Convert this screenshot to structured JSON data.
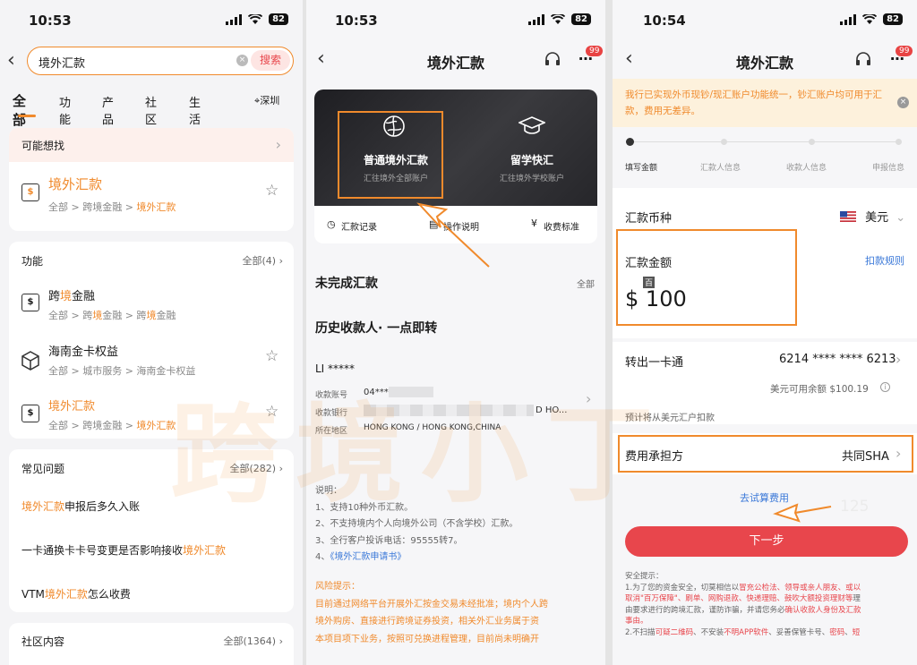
{
  "panel1": {
    "status": {
      "time": "10:53",
      "battery": "82"
    },
    "search": {
      "value": "境外汇款",
      "button": "搜索"
    },
    "tabs": [
      "全部",
      "功能",
      "产品",
      "社区",
      "生活"
    ],
    "location": "深圳",
    "maybe": {
      "title": "可能想找",
      "name": "境外汇款",
      "path_a": "全部 > 跨境金融 > ",
      "path_b": "境外汇款"
    },
    "functions": {
      "title": "功能",
      "all": "全部(4)",
      "items": [
        {
          "name_a": "跨",
          "name_b": "境",
          "name_c": "金融",
          "path_a": "全部 > 跨",
          "path_b": "境",
          "path_c": "金融 > 跨",
          "path_d": "境",
          "path_e": "金融"
        },
        {
          "name": "海南金卡权益",
          "path": "全部 > 城市服务 > 海南金卡权益"
        },
        {
          "name": "境外汇款",
          "path_a": "全部 > 跨境金融 > ",
          "path_b": "境外汇款"
        }
      ]
    },
    "faq": {
      "title": "常见问题",
      "all": "全部(282)",
      "q1_a": "境外汇款",
      "q1_b": "申报后多久入账",
      "q2_a": "一卡通换卡卡号变更是否影响接收",
      "q2_b": "境外汇款",
      "q3_a": "VTM",
      "q3_b": "境外汇款",
      "q3_c": "怎么收费"
    },
    "community": {
      "title": "社区内容",
      "all": "全部(1364)"
    }
  },
  "panel2": {
    "status": {
      "time": "10:53",
      "battery": "82"
    },
    "title": "境外汇款",
    "badge": "99",
    "banner": {
      "opt1_title": "普通境外汇款",
      "opt1_sub": "汇往境外全部账户",
      "opt2_title": "留学快汇",
      "opt2_sub": "汇往境外学校账户"
    },
    "links": [
      "汇款记录",
      "操作说明",
      "收费标准"
    ],
    "pending": {
      "title": "未完成汇款",
      "all": "全部"
    },
    "history_title": "历史收款人· 一点即转",
    "payee": {
      "name": "LI *****",
      "acct_label": "收款账号",
      "acct_value": "04***",
      "bank_label": "收款银行",
      "bank_value": "D HO...",
      "region_label": "所在地区",
      "region_value": "HONG KONG / HONG KONG,CHINA"
    },
    "notes": {
      "title": "说明：",
      "l1": "1、支持10种外币汇款。",
      "l2": "2、不支持境内个人向境外公司（不含学校）汇款。",
      "l3": "3、全行客户投诉电话：95555转7。",
      "l4_a": "4、",
      "l4_b": "《境外汇款申请书》"
    },
    "risk": {
      "title": "风险提示：",
      "l1": "目前通过网络平台开展外汇按金交易未经批准；境内个人跨",
      "l2": "境外购房、直接进行跨境证券投资，相关外汇业务属于资",
      "l3": "本项目项下业务，按照可兑换进程管理，目前尚未明确开"
    }
  },
  "panel3": {
    "status": {
      "time": "10:54",
      "battery": "82"
    },
    "title": "境外汇款",
    "badge": "99",
    "notice": "我行已实现外币现钞/现汇账户功能统一，钞汇账户均可用于汇款，费用无差异。",
    "steps": [
      "填写金额",
      "汇款人信息",
      "收款人信息",
      "申报信息"
    ],
    "currency": {
      "label": "汇款币种",
      "value": "美元"
    },
    "amount": {
      "label": "汇款金额",
      "rule": "扣款规则",
      "unit_hint": "百",
      "symbol": "$",
      "value": "100"
    },
    "account": {
      "label": "转出一卡通",
      "value": "6214 **** **** 6213",
      "balance": "美元可用余额 $100.19",
      "deduct_note": "预计将从美元汇户扣款"
    },
    "fee": {
      "label": "费用承担方",
      "value": "共同SHA"
    },
    "trial": "去试算费用",
    "faint_number": "125",
    "next_button": "下一步",
    "safety": {
      "title": "安全提示：",
      "p1_a": "1.为了您的资金安全，切莫相信以",
      "p1_b": "冒充公检法、领导或亲人朋友、或以",
      "p1_c": "取消\"百万保障\"、刷单、网购退款、快递理赔、鼓吹大额投资理财等",
      "p1_d": "理",
      "p1_e": "由要求进行的跨境汇款，谨防诈骗，并请您务必",
      "p1_f": "确认收款人身份及汇款",
      "p1_g": "事由。",
      "p2_a": "2.不扫描",
      "p2_b": "可疑二维码",
      "p2_c": "、不安装",
      "p2_d": "不明APP软件",
      "p2_e": "、妥善保管卡号、",
      "p2_f": "密码",
      "p2_g": "、",
      "p2_h": "短"
    }
  },
  "watermark": "跨境小丁",
  "colors": {
    "accent": "#f08a2c",
    "button": "#e8464c",
    "notice_bg": "#fdf1dc"
  }
}
